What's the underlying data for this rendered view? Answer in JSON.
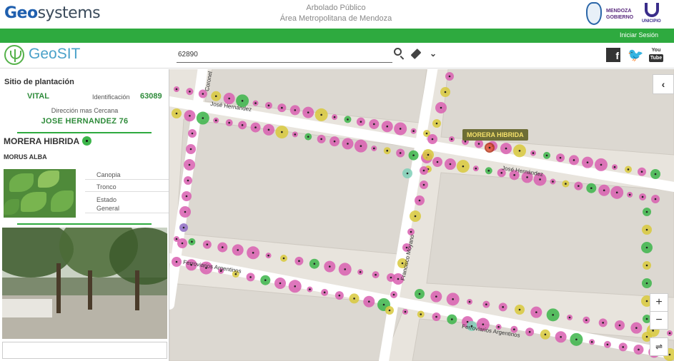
{
  "header": {
    "brand_bold": "Geo",
    "brand_rest": "systems",
    "title_line1": "Arbolado Público",
    "title_line2": "Área Metropolitana de Mendoza",
    "gov_logo_text": "MENDOZA GOBIERNO",
    "uni_logo_text": "UNICIPIO"
  },
  "greenbar": {
    "login_label": "Iniciar Sesión"
  },
  "toolbar": {
    "app_name": "GeoSIT",
    "search_value": "62890",
    "icons": [
      "search-icon",
      "eraser-icon",
      "chevron-down-icon",
      "facebook-icon",
      "twitter-icon",
      "youtube-icon"
    ],
    "youtube_top": "You",
    "youtube_bottom": "Tube"
  },
  "sidebar": {
    "section_title": "Sitio de plantación",
    "status": "VITAL",
    "id_label": "Identificación",
    "id_value": "63089",
    "address_label": "Dirección mas Cercana",
    "address_value": "JOSE HERNANDEZ 76",
    "species": "MORERA HIBRIDA",
    "scientific_name": "MORUS ALBA",
    "attributes": [
      "Canopia",
      "Tronco",
      "Estado",
      "General"
    ]
  },
  "map": {
    "streets": [
      "José Hernández",
      "José Hernández",
      "Coronel",
      "Francisco Moyano",
      "Ferroviarios Argentinos",
      "Ferroviarios Argentinos"
    ],
    "tooltip": "MORERA HIBRIDA",
    "collapse_symbol": "‹",
    "zoom_in": "+",
    "zoom_out": "−",
    "layers_symbol": "⇌",
    "colors": {
      "pink": "#d85fb0",
      "green": "#3cb54a",
      "yellow": "#d8c93c",
      "purple": "#8e6bc4",
      "teal": "#7fd0b8",
      "selected": "#e2593a"
    }
  }
}
